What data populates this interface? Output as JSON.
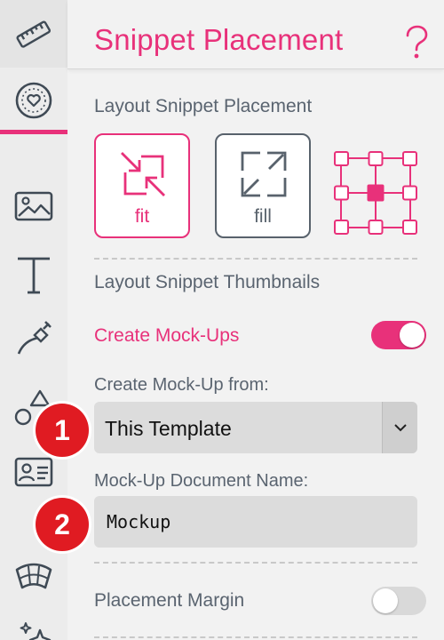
{
  "header": {
    "title": "Snippet Placement",
    "help_icon": "question-icon"
  },
  "sidebar": {
    "items": [
      {
        "icon": "ruler-icon"
      },
      {
        "icon": "heart-circle-icon",
        "active": true
      },
      {
        "icon": "image-icon"
      },
      {
        "icon": "text-icon"
      },
      {
        "icon": "pen-tool-icon"
      },
      {
        "icon": "shapes-icon"
      },
      {
        "icon": "contact-card-icon"
      },
      {
        "icon": "warp-icon"
      },
      {
        "icon": "sparkle-icon"
      }
    ]
  },
  "placement": {
    "section_label": "Layout Snippet Placement",
    "fit_label": "fit",
    "fill_label": "fill",
    "selected": "fit"
  },
  "thumbnails": {
    "section_label": "Layout Snippet Thumbnails",
    "create_mockups_label": "Create Mock-Ups",
    "create_mockups_on": true,
    "from_label": "Create Mock-Up from:",
    "from_value": "This Template",
    "doc_name_label": "Mock-Up Document Name:",
    "doc_name_value": "Mockup"
  },
  "margin": {
    "label": "Placement Margin",
    "on": false
  },
  "markers": [
    "1",
    "2"
  ],
  "colors": {
    "accent": "#e8317a",
    "marker": "#e01b22",
    "text": "#5a6470"
  }
}
